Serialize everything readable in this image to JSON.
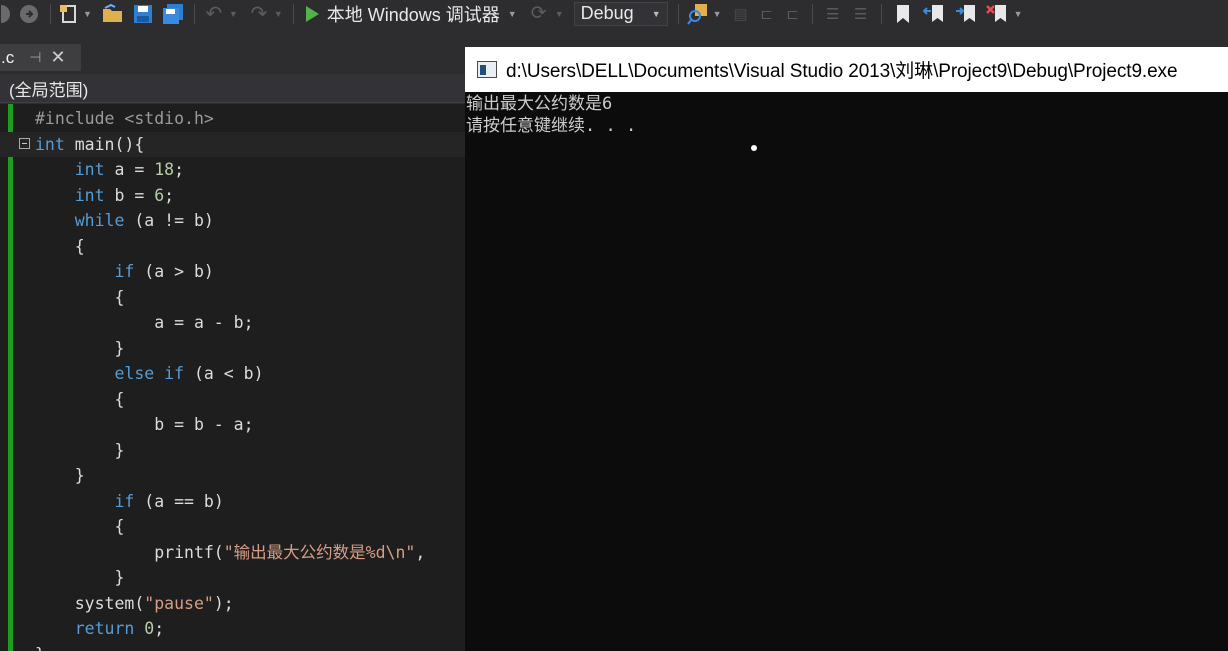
{
  "toolbar": {
    "icons": [
      "back-icon",
      "forward-icon",
      "new-project-icon",
      "open-file-icon",
      "save-icon",
      "save-all-icon",
      "undo-icon",
      "redo-icon",
      "run-icon",
      "refresh-icon",
      "find-in-files-icon",
      "comment-icon",
      "uncomment-icon",
      "outdent-icon",
      "indent-icon",
      "bookmark-icon",
      "prev-bookmark-icon",
      "next-bookmark-icon",
      "clear-bookmarks-icon"
    ],
    "run_label": "本地 Windows 调试器",
    "configuration": "Debug"
  },
  "editor": {
    "tab_label": ".c",
    "scope": "(全局范围)",
    "lines": [
      {
        "tokens": [
          {
            "t": "#include <stdio.h>",
            "c": "pp"
          }
        ]
      },
      {
        "tokens": [
          {
            "t": "int",
            "c": "kw"
          },
          {
            "t": " main(){",
            "c": "txt"
          }
        ]
      },
      {
        "tokens": [
          {
            "t": "    ",
            "c": "txt"
          },
          {
            "t": "int",
            "c": "kw"
          },
          {
            "t": " a = ",
            "c": "txt"
          },
          {
            "t": "18",
            "c": "num"
          },
          {
            "t": ";",
            "c": "txt"
          }
        ]
      },
      {
        "tokens": [
          {
            "t": "    ",
            "c": "txt"
          },
          {
            "t": "int",
            "c": "kw"
          },
          {
            "t": " b = ",
            "c": "txt"
          },
          {
            "t": "6",
            "c": "num"
          },
          {
            "t": ";",
            "c": "txt"
          }
        ]
      },
      {
        "tokens": [
          {
            "t": "    ",
            "c": "txt"
          },
          {
            "t": "while",
            "c": "kw"
          },
          {
            "t": " (a != b)",
            "c": "txt"
          }
        ]
      },
      {
        "tokens": [
          {
            "t": "    {",
            "c": "txt"
          }
        ]
      },
      {
        "tokens": [
          {
            "t": "        ",
            "c": "txt"
          },
          {
            "t": "if",
            "c": "kw"
          },
          {
            "t": " (a > b)",
            "c": "txt"
          }
        ]
      },
      {
        "tokens": [
          {
            "t": "        {",
            "c": "txt"
          }
        ]
      },
      {
        "tokens": [
          {
            "t": "            a = a - b;",
            "c": "txt"
          }
        ]
      },
      {
        "tokens": [
          {
            "t": "        }",
            "c": "txt"
          }
        ]
      },
      {
        "tokens": [
          {
            "t": "        ",
            "c": "txt"
          },
          {
            "t": "else",
            "c": "kw"
          },
          {
            "t": " ",
            "c": "txt"
          },
          {
            "t": "if",
            "c": "kw"
          },
          {
            "t": " (a < b)",
            "c": "txt"
          }
        ]
      },
      {
        "tokens": [
          {
            "t": "        {",
            "c": "txt"
          }
        ]
      },
      {
        "tokens": [
          {
            "t": "            b = b - a;",
            "c": "txt"
          }
        ]
      },
      {
        "tokens": [
          {
            "t": "        }",
            "c": "txt"
          }
        ]
      },
      {
        "tokens": [
          {
            "t": "    }",
            "c": "txt"
          }
        ]
      },
      {
        "tokens": [
          {
            "t": "        ",
            "c": "txt"
          },
          {
            "t": "if",
            "c": "kw"
          },
          {
            "t": " (a == b)",
            "c": "txt"
          }
        ]
      },
      {
        "tokens": [
          {
            "t": "        {",
            "c": "txt"
          }
        ]
      },
      {
        "tokens": [
          {
            "t": "            printf(",
            "c": "txt"
          },
          {
            "t": "\"输出最大公约数是%d\\n\"",
            "c": "str"
          },
          {
            "t": ",",
            "c": "txt"
          }
        ]
      },
      {
        "tokens": [
          {
            "t": "        }",
            "c": "txt"
          }
        ]
      },
      {
        "tokens": [
          {
            "t": "    system(",
            "c": "txt"
          },
          {
            "t": "\"pause\"",
            "c": "str"
          },
          {
            "t": ");",
            "c": "txt"
          }
        ]
      },
      {
        "tokens": [
          {
            "t": "    ",
            "c": "txt"
          },
          {
            "t": "return",
            "c": "kw"
          },
          {
            "t": " ",
            "c": "txt"
          },
          {
            "t": "0",
            "c": "num"
          },
          {
            "t": ";",
            "c": "txt"
          }
        ]
      },
      {
        "tokens": [
          {
            "t": "}",
            "c": "txt"
          }
        ]
      }
    ]
  },
  "console": {
    "title": "d:\\Users\\DELL\\Documents\\Visual Studio 2013\\刘琳\\Project9\\Debug\\Project9.exe",
    "output_line1": "输出最大公约数是6",
    "output_line2": "请按任意键继续. . ."
  }
}
